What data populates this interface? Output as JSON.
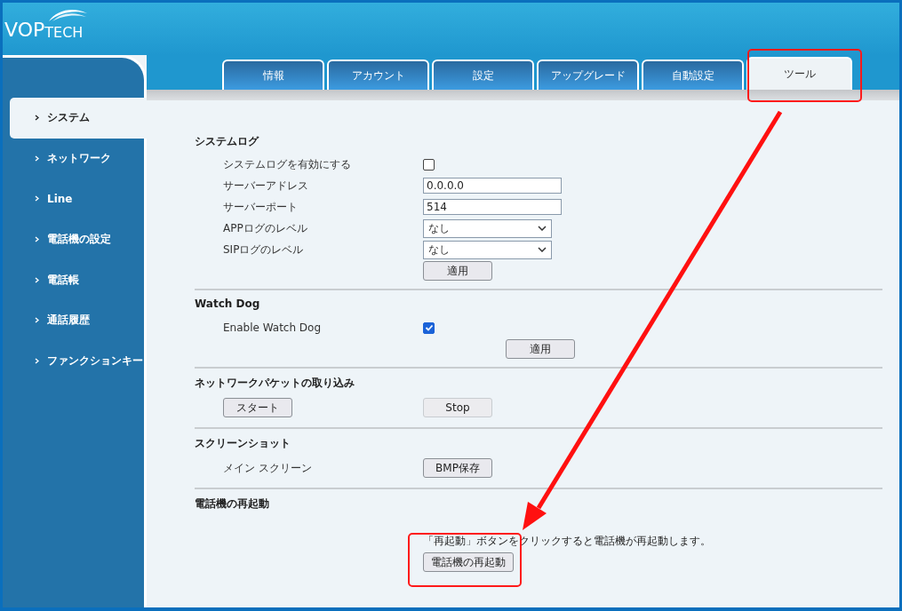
{
  "logo": {
    "main": "VOP",
    "sub": "TECH"
  },
  "tabs": [
    {
      "label": "情報",
      "selected": false
    },
    {
      "label": "アカウント",
      "selected": false
    },
    {
      "label": "設定",
      "selected": false
    },
    {
      "label": "アップグレード",
      "selected": false
    },
    {
      "label": "自動設定",
      "selected": false
    },
    {
      "label": "ツール",
      "selected": true
    }
  ],
  "sidebar": {
    "items": [
      {
        "label": "システム",
        "selected": true
      },
      {
        "label": "ネットワーク",
        "selected": false
      },
      {
        "label": "Line",
        "selected": false
      },
      {
        "label": "電話機の設定",
        "selected": false
      },
      {
        "label": "電話帳",
        "selected": false
      },
      {
        "label": "通話履歴",
        "selected": false
      },
      {
        "label": "ファンクションキー",
        "selected": false
      }
    ]
  },
  "sections": [
    {
      "title": "システムログ",
      "rows": [
        {
          "kind": "checkbox",
          "label": "システムログを有効にする",
          "checked": false
        },
        {
          "kind": "text",
          "label": "サーバーアドレス",
          "value": "0.0.0.0"
        },
        {
          "kind": "text",
          "label": "サーバーポート",
          "value": "514"
        },
        {
          "kind": "select",
          "label": "APPログのレベル",
          "value": "なし"
        },
        {
          "kind": "select",
          "label": "SIPログのレベル",
          "value": "なし"
        },
        {
          "kind": "button",
          "button": "適用"
        }
      ]
    },
    {
      "title": "Watch Dog",
      "rows": [
        {
          "kind": "checkbox",
          "label": "Enable Watch Dog",
          "checked": true
        },
        {
          "kind": "button-right",
          "button": "適用"
        }
      ]
    },
    {
      "title": "ネットワークパケットの取り込み",
      "rows": [
        {
          "kind": "two-buttons",
          "buttons": [
            "スタート",
            "Stop"
          ]
        }
      ]
    },
    {
      "title": "スクリーンショット",
      "rows": [
        {
          "kind": "label-button",
          "label": "メイン スクリーン",
          "button": "BMP保存"
        }
      ]
    },
    {
      "title": "電話機の再起動",
      "rows": [
        {
          "kind": "note",
          "text": "「再起動」ボタンをクリックすると電話機が再起動します。"
        },
        {
          "kind": "button",
          "button": "電話機の再起動"
        }
      ]
    }
  ]
}
